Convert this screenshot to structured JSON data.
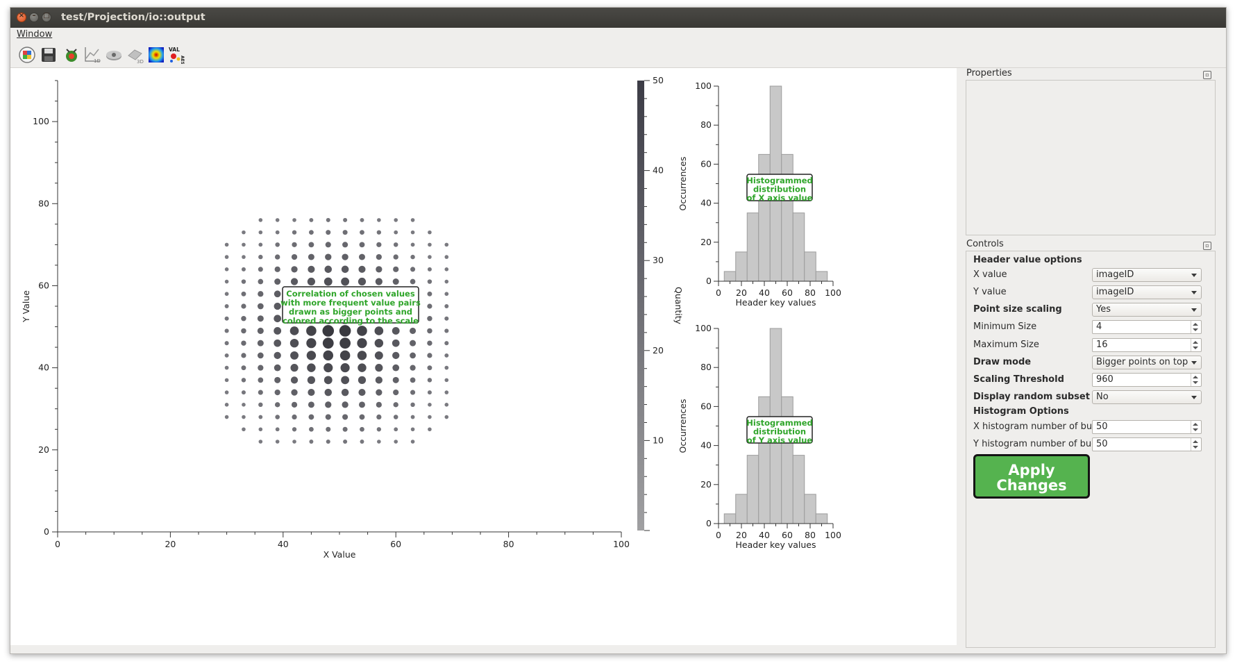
{
  "window": {
    "title": "test/Projection/io::output",
    "menu": [
      "Window"
    ]
  },
  "toolbar": {
    "icons": [
      "layout-icon",
      "save-icon",
      "bug-icon",
      "plot-2d-icon",
      "hardware-icon",
      "plot-3d-icon",
      "heatmap-icon",
      "valaes-icon"
    ],
    "valaes_text": "VAL AES"
  },
  "scatter": {
    "xlabel": "X Value",
    "ylabel": "Y Value",
    "x_ticks": [
      "0",
      "20",
      "40",
      "60",
      "80",
      "100"
    ],
    "y_ticks": [
      "0",
      "20",
      "40",
      "60",
      "80",
      "100"
    ],
    "colorbar_label": "Quantity",
    "colorbar_ticks": [
      "10",
      "20",
      "30",
      "40",
      "50"
    ],
    "annotation": [
      "Correlation of chosen values",
      "with more frequent value pairs",
      "drawn as bigger points and",
      "colored according to the scale"
    ]
  },
  "hist_x": {
    "xlabel": "Header key values",
    "ylabel": "Occurrences",
    "x_ticks": [
      "0",
      "20",
      "40",
      "60",
      "80",
      "100"
    ],
    "y_ticks": [
      "0",
      "20",
      "40",
      "60",
      "80",
      "100"
    ],
    "annotation": [
      "Histogrammed",
      "distribution",
      "of X axis value"
    ]
  },
  "hist_y": {
    "xlabel": "Header key values",
    "ylabel": "Occurrences",
    "x_ticks": [
      "0",
      "20",
      "40",
      "60",
      "80",
      "100"
    ],
    "y_ticks": [
      "0",
      "20",
      "40",
      "60",
      "80",
      "100"
    ],
    "annotation": [
      "Histogrammed",
      "distribution",
      "of Y axis value"
    ]
  },
  "chart_data": [
    {
      "type": "scatter",
      "title": "",
      "xlabel": "X Value",
      "ylabel": "Y Value",
      "xlim": [
        0,
        100
      ],
      "ylim": [
        0,
        110
      ],
      "colorbar": {
        "label": "Quantity",
        "range": [
          0,
          50
        ]
      },
      "x": [
        30,
        33,
        36,
        39,
        42,
        45,
        48,
        51,
        54,
        57,
        60,
        63,
        66,
        69
      ],
      "y": [
        22,
        25,
        28,
        31,
        34,
        37,
        40,
        43,
        46,
        49,
        52,
        55,
        58,
        61,
        64,
        67,
        70,
        73,
        76
      ],
      "note": "grid of points; bigger and darker toward the center"
    },
    {
      "type": "bar",
      "title": "",
      "xlabel": "Header key values",
      "ylabel": "Occurrences",
      "xlim": [
        0,
        100
      ],
      "ylim": [
        0,
        100
      ],
      "bin_edges": [
        5,
        15,
        25,
        35,
        45,
        55,
        65,
        75,
        85,
        95
      ],
      "values": [
        5,
        15,
        35,
        65,
        100,
        65,
        35,
        15,
        5
      ]
    },
    {
      "type": "bar",
      "title": "",
      "xlabel": "Header key values",
      "ylabel": "Occurrences",
      "xlim": [
        0,
        100
      ],
      "ylim": [
        0,
        100
      ],
      "bin_edges": [
        5,
        15,
        25,
        35,
        45,
        55,
        65,
        75,
        85,
        95
      ],
      "values": [
        5,
        15,
        35,
        65,
        100,
        65,
        35,
        15,
        5
      ]
    }
  ],
  "properties": {
    "title": "Properties"
  },
  "controls": {
    "title": "Controls",
    "header_value_options": "Header value options",
    "x_value_label": "X value",
    "x_value": "imageID",
    "y_value_label": "Y value",
    "y_value": "imageID",
    "point_size_scaling_label": "Point size scaling",
    "point_size_scaling": "Yes",
    "minimum_size_label": "Minimum Size",
    "minimum_size": "4",
    "maximum_size_label": "Maximum Size",
    "maximum_size": "16",
    "draw_mode_label": "Draw mode",
    "draw_mode": "Bigger points on top",
    "scaling_threshold_label": "Scaling Threshold",
    "scaling_threshold": "960",
    "display_random_subset_label": "Display random subset",
    "display_random_subset": "No",
    "histogram_options": "Histogram Options",
    "x_buckets_label": "X histogram number of buckets",
    "x_buckets": "50",
    "y_buckets_label": "Y histogram number of buckets",
    "y_buckets": "50",
    "apply_label_1": "Apply",
    "apply_label_2": "Changes"
  },
  "colors": {
    "accent_green": "#2fa52a",
    "apply_green": "#55b34f",
    "bar_fill": "#c8c8c8",
    "point_dark": "#3a3a42",
    "point_light": "#7a7a7a"
  }
}
